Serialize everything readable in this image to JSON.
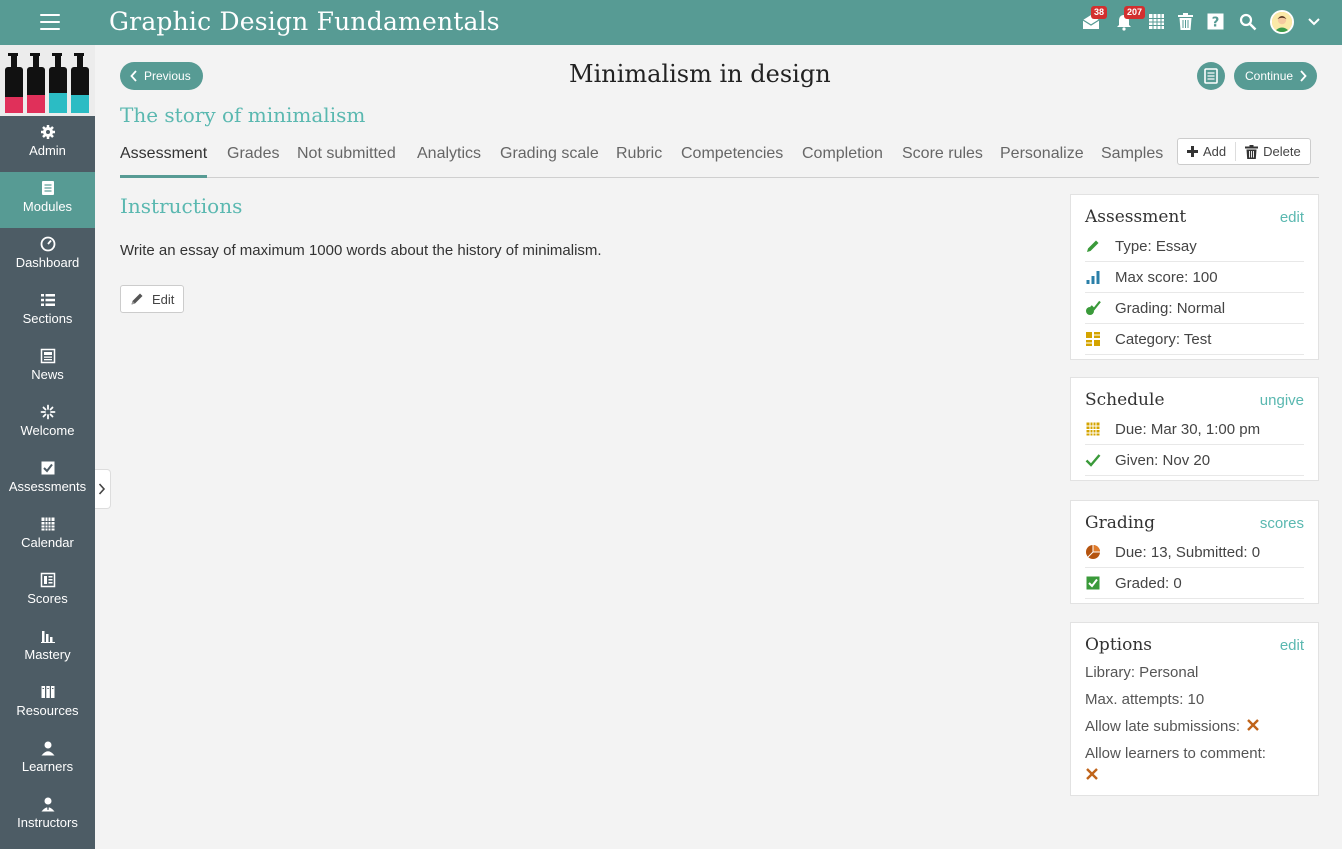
{
  "app": {
    "title": "Graphic Design Fundamentals",
    "messages_count": "38",
    "notifications_count": "207"
  },
  "sidebar": {
    "items": [
      {
        "label": "Admin",
        "icon": "gear-icon"
      },
      {
        "label": "Modules",
        "icon": "modules-icon",
        "active": true
      },
      {
        "label": "Dashboard",
        "icon": "dashboard-icon"
      },
      {
        "label": "Sections",
        "icon": "sections-icon"
      },
      {
        "label": "News",
        "icon": "news-icon"
      },
      {
        "label": "Welcome",
        "icon": "welcome-icon"
      },
      {
        "label": "Assessments",
        "icon": "assessments-icon"
      },
      {
        "label": "Calendar",
        "icon": "calendar-icon"
      },
      {
        "label": "Scores",
        "icon": "scores-icon"
      },
      {
        "label": "Mastery",
        "icon": "mastery-icon"
      },
      {
        "label": "Resources",
        "icon": "resources-icon"
      },
      {
        "label": "Learners",
        "icon": "learner-icon"
      },
      {
        "label": "Instructors",
        "icon": "instructor-icon"
      }
    ]
  },
  "nav": {
    "previous": "Previous",
    "continue": "Continue"
  },
  "page": {
    "title": "Minimalism in design",
    "section_title": "The story of minimalism"
  },
  "tabs": [
    {
      "label": "Assessment",
      "active": true
    },
    {
      "label": "Grades"
    },
    {
      "label": "Not submitted"
    },
    {
      "label": "Analytics"
    },
    {
      "label": "Grading scale"
    },
    {
      "label": "Rubric"
    },
    {
      "label": "Competencies"
    },
    {
      "label": "Completion"
    },
    {
      "label": "Score rules"
    },
    {
      "label": "Personalize"
    },
    {
      "label": "Samples"
    }
  ],
  "tab_actions": {
    "add": "Add",
    "delete": "Delete"
  },
  "instructions": {
    "title": "Instructions",
    "text": "Write an essay of maximum 1000 words about the history of minimalism.",
    "edit_label": "Edit"
  },
  "panels": {
    "assessment": {
      "title": "Assessment",
      "link": "edit",
      "rows": [
        {
          "text": "Type: Essay",
          "icon": "pencil-icon",
          "color": "#3a9a3a"
        },
        {
          "text": "Max score: 100",
          "icon": "bar-chart-icon",
          "color": "#2a7fa8"
        },
        {
          "text": "Grading: Normal",
          "icon": "grading-check-icon",
          "color": "#3a9a3a"
        },
        {
          "text": "Category: Test",
          "icon": "category-icon",
          "color": "#d4a400"
        }
      ]
    },
    "schedule": {
      "title": "Schedule",
      "link": "ungive",
      "rows": [
        {
          "text": "Due: Mar 30, 1:00 pm",
          "icon": "calendar-grid-icon",
          "color": "#d4a400"
        },
        {
          "text": "Given: Nov 20",
          "icon": "checkmark-icon",
          "color": "#3a9a3a"
        }
      ]
    },
    "grading": {
      "title": "Grading",
      "link": "scores",
      "rows": [
        {
          "text": "Due: 13, Submitted: 0",
          "icon": "pie-icon",
          "color": "#b5540f"
        },
        {
          "text": "Graded: 0",
          "icon": "checkbox-icon",
          "color": "#3a9a3a"
        }
      ]
    },
    "options": {
      "title": "Options",
      "link": "edit",
      "library": "Library: Personal",
      "max_attempts": "Max. attempts: 10",
      "late": "Allow late submissions:",
      "comment": "Allow learners to comment:",
      "x_color": "#c0641a"
    }
  },
  "colors": {
    "accent": "#579b94",
    "accent_text": "#5ab8b0",
    "sidebar": "#4d5c65"
  }
}
